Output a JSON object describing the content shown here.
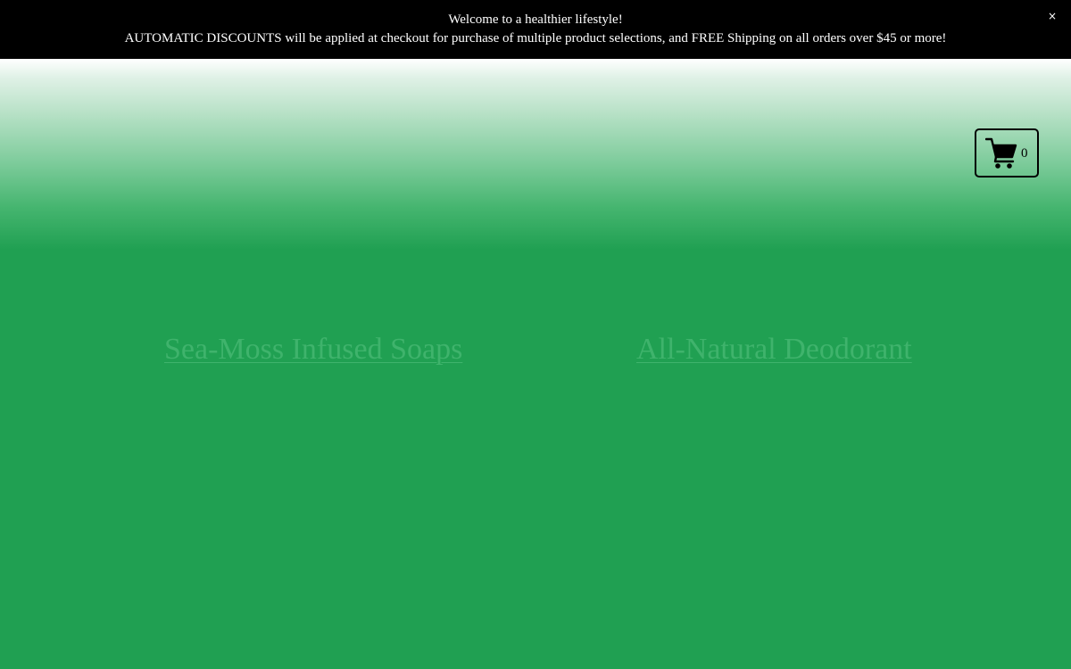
{
  "announcement": {
    "line1": "Welcome to a healthier lifestyle!",
    "line2": "AUTOMATIC DISCOUNTS will be applied at checkout for purchase of multiple product selections, and FREE Shipping on all orders over $45 or more!",
    "close_label": "×"
  },
  "cart": {
    "icon": "shopping-cart-icon",
    "count": "0"
  },
  "categories": [
    {
      "label": "Sea-Moss Infused Soaps"
    },
    {
      "label": "All-Natural Deodorant"
    }
  ],
  "colors": {
    "announcement_bg": "#000000",
    "page_green": "#20a052",
    "link_green": "#3fb36c"
  }
}
